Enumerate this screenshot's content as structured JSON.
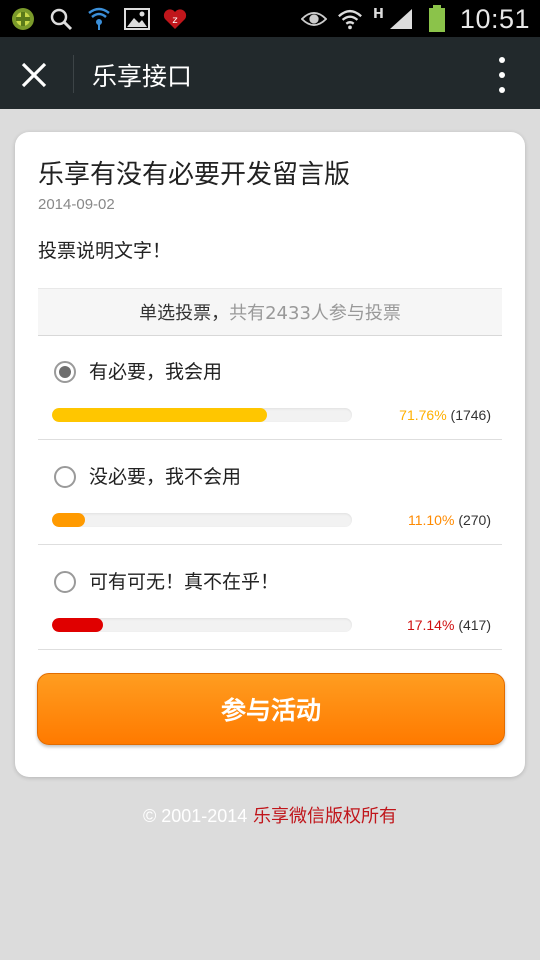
{
  "status_bar": {
    "time": "10:51",
    "network_letter": "H",
    "icons": [
      "app-icon",
      "search-icon",
      "wifi-signal-icon",
      "image-icon",
      "notification-icon",
      "eye-icon",
      "wifi-icon",
      "cellular-signal-icon",
      "battery-icon"
    ]
  },
  "title_bar": {
    "title": "乐享接口",
    "close_icon": "close-icon",
    "more_icon": "more-vertical-icon"
  },
  "vote": {
    "title": "乐享有没有必要开发留言版",
    "date": "2014-09-02",
    "description": "投票说明文字！",
    "summary_type": "单选投票，",
    "summary_count": "共有2433人参与投票",
    "options": [
      {
        "label": "有必要，我会用",
        "percent_text": "71.76%",
        "count_text": "(1746)",
        "fraction": 0.7176,
        "checked": true,
        "color": "#ffc600",
        "percent_color": "#ffb000"
      },
      {
        "label": "没必要，我不会用",
        "percent_text": "11.10%",
        "count_text": "(270)",
        "fraction": 0.111,
        "checked": false,
        "color": "#ff9a00",
        "percent_color": "#ff8a00"
      },
      {
        "label": "可有可无！真不在乎！",
        "percent_text": "17.14%",
        "count_text": "(417)",
        "fraction": 0.1714,
        "checked": false,
        "color": "#e00000",
        "percent_color": "#d01010"
      }
    ],
    "join_button": "参与活动"
  },
  "footer": {
    "copyright": "© 2001-2014",
    "owner": "乐享微信版权所有"
  },
  "colors": {
    "title_bar": "#22292c",
    "button": "#ff8a00",
    "footer_owner": "#c0161b"
  }
}
